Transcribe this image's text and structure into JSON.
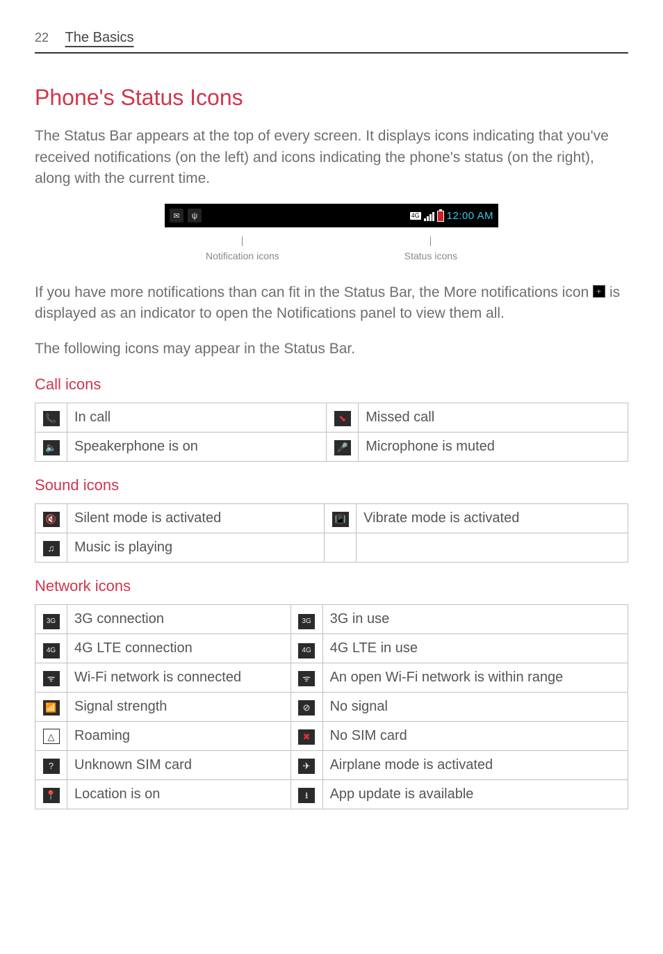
{
  "page": {
    "number": "22",
    "section": "The Basics"
  },
  "title": "Phone's Status Icons",
  "intro": "The Status Bar appears at the top of every screen. It displays icons indicating that you've received notifications (on the left) and icons indicating the phone's status (on the right), along with the current time.",
  "figure": {
    "time": "12:00 AM",
    "callout_left": "Notification icons",
    "callout_right": "Status icons"
  },
  "para2_a": "If you have more notifications than can fit in the Status Bar, the More notifications icon ",
  "para2_b": " is displayed as an indicator to open the Notifications panel to view them all.",
  "para3": "The following icons may appear in the Status Bar.",
  "sections": {
    "call": {
      "heading": "Call icons",
      "rows": [
        {
          "l_icon": "phone-icon",
          "l_glyph": "📞",
          "l": "In call",
          "r_icon": "missed-call-icon",
          "r_glyph": "⬊",
          "r": "Missed call"
        },
        {
          "l_icon": "speakerphone-icon",
          "l_glyph": "🔈",
          "l": "Speakerphone is on",
          "r_icon": "mic-mute-icon",
          "r_glyph": "🎤",
          "r": "Microphone is muted"
        }
      ]
    },
    "sound": {
      "heading": "Sound icons",
      "rows": [
        {
          "l_icon": "silent-icon",
          "l_glyph": "🔇",
          "l": "Silent mode is activated",
          "r_icon": "vibrate-icon",
          "r_glyph": "📳",
          "r": "Vibrate mode is activated"
        },
        {
          "l_icon": "music-icon",
          "l_glyph": "♫",
          "l": "Music is playing",
          "r_icon": "",
          "r_glyph": "",
          "r": ""
        }
      ]
    },
    "network": {
      "heading": "Network icons",
      "rows": [
        {
          "l_icon": "3g-conn-icon",
          "l_glyph": "3G",
          "l": "3G connection",
          "r_icon": "3g-use-icon",
          "r_glyph": "3G",
          "r": "3G in use"
        },
        {
          "l_icon": "4g-conn-icon",
          "l_glyph": "4G",
          "l": "4G LTE connection",
          "r_icon": "4g-use-icon",
          "r_glyph": "4G",
          "r": "4G LTE in use"
        },
        {
          "l_icon": "wifi-icon",
          "l_glyph": "ᯤ",
          "l": "Wi-Fi network is connected",
          "r_icon": "wifi-open-icon",
          "r_glyph": "ᯤ",
          "r": "An open Wi-Fi network is within range"
        },
        {
          "l_icon": "signal-icon",
          "l_glyph": "📶",
          "l": "Signal strength",
          "r_icon": "no-signal-icon",
          "r_glyph": "⊘",
          "r": "No signal"
        },
        {
          "l_icon": "roaming-icon",
          "l_glyph": "△",
          "l": "Roaming",
          "r_icon": "no-sim-icon",
          "r_glyph": "✖",
          "r": "No SIM card"
        },
        {
          "l_icon": "unknown-sim-icon",
          "l_glyph": "?",
          "l": "Unknown SIM card",
          "r_icon": "airplane-icon",
          "r_glyph": "✈",
          "r": "Airplane mode is activated"
        },
        {
          "l_icon": "location-icon",
          "l_glyph": "📍",
          "l": "Location is on",
          "r_icon": "update-icon",
          "r_glyph": "⭳",
          "r": "App update is available"
        }
      ]
    }
  }
}
